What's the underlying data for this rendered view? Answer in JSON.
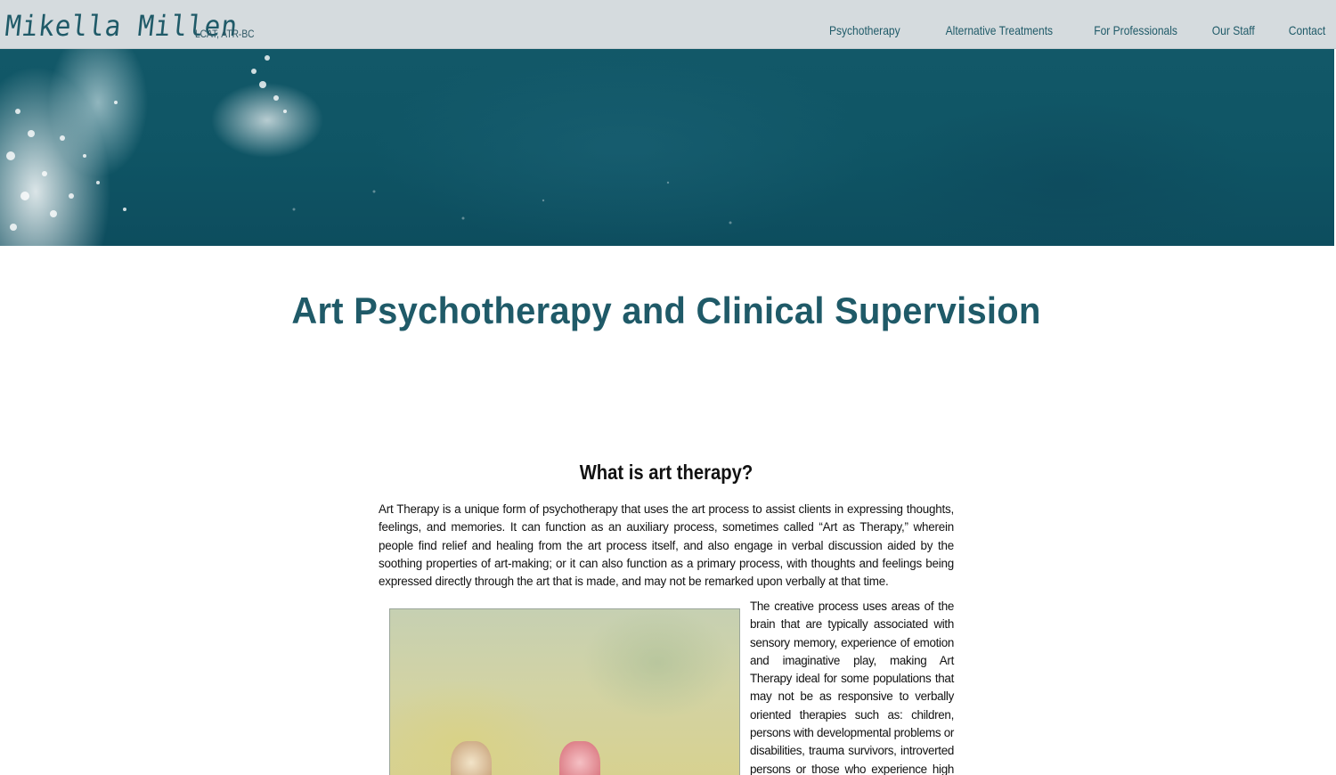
{
  "brand": {
    "name": "Mikella Millen",
    "credentials": "LCAT, ATR-BC"
  },
  "nav": {
    "items": [
      {
        "label": "Psychotherapy"
      },
      {
        "label": "Alternative Treatments"
      },
      {
        "label": "For Professionals"
      },
      {
        "label": "Our Staff"
      },
      {
        "label": "Contact"
      }
    ]
  },
  "page": {
    "title": "Art Psychotherapy and Clinical Supervision"
  },
  "section": {
    "heading": "What is art therapy?",
    "paragraph1": "Art Therapy is a unique form of psychotherapy that uses the art process to assist clients in expressing thoughts, feelings, and memories. It can function as an auxiliary process, sometimes called “Art as Therapy,” wherein people find relief and healing from the art process itself, and also engage in verbal discussion aided by the soothing properties of art-making; or it can also function as a primary process, with thoughts and feelings being expressed directly through the art that is made, and may not be remarked upon verbally at that time.",
    "paragraph2": "The creative process uses areas of the brain that are typically associated with sensory memory, experience of emotion and imaginative play, making Art Therapy ideal for some populations that may not be as responsive to verbally oriented therapies such as: children, persons with developmental problems or disabilities, trauma survivors, introverted persons or those who experience high levels of anxiety, traumatic brain injuries,"
  },
  "colors": {
    "accent": "#1f5a68",
    "topbar": "#d5dbde",
    "hero": "#0f5565"
  }
}
